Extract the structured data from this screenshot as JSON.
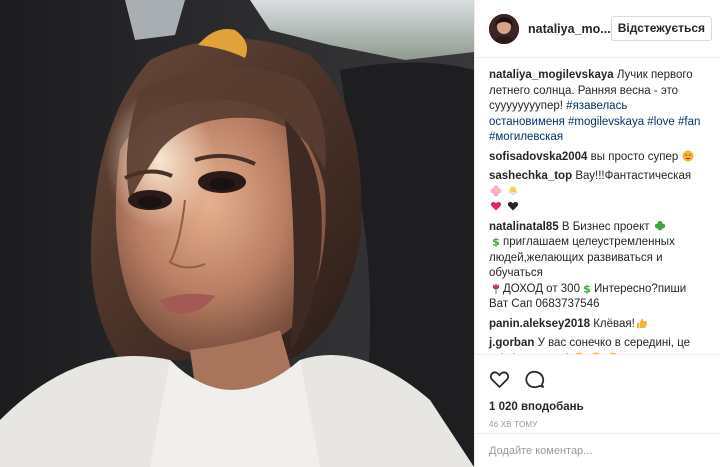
{
  "header": {
    "username": "nataliya_mo...",
    "follow_label": "Відстежується"
  },
  "caption": {
    "user": "nataliya_mogilevskaya",
    "text": "Лучик первого летнего солнца. Ранняя весна - это суууууууупер!",
    "hashtags": "#язавелась остановименя #mogilevskaya #love #fan #могилевская"
  },
  "comments": [
    {
      "user": "sofisadovska2004",
      "text": "вы просто супер",
      "icons": [
        "heart-eyes-emoji-icon"
      ]
    },
    {
      "user": "sashechka_top",
      "text": "Вау!!!Фантастическая",
      "icons": [
        "blossom-emoji-icon",
        "chick-emoji-icon",
        "heart-red-emoji-icon",
        "heart-black-emoji-icon"
      ]
    },
    {
      "user": "natalinatal85",
      "text_1": "В Бизнес проект",
      "text_2": "приглашаем целеустремленных людей,желающих развиваться и обучаться",
      "text_3": "ДОХОД от 300",
      "text_4": "Интересно?пиши Ват Сап 0683737546",
      "icons": [
        "clover-emoji-icon",
        "dollar-emoji-icon",
        "tulip-emoji-icon",
        "dollar-emoji-icon"
      ]
    },
    {
      "user": "panin.aleksey2018",
      "text": "Клёвая!",
      "icons": [
        "thumbs-up-emoji-icon"
      ]
    },
    {
      "user": "j.gorban",
      "text": "У вас сонечко в середині, це всі відчувають!",
      "icons": [
        "sunflower-emoji-icon",
        "sunflower-emoji-icon",
        "sunflower-emoji-icon"
      ]
    }
  ],
  "footer": {
    "likes": "1 020 вподобань",
    "time": "46 ХВ ТОМУ",
    "comment_placeholder": "Додайте коментар..."
  },
  "icons": {
    "like": "heart-outline-icon",
    "comment": "speech-bubble-icon"
  },
  "colors": {
    "text": "#262626",
    "hashtag": "#003569",
    "muted": "#999999",
    "border": "#efefef"
  }
}
